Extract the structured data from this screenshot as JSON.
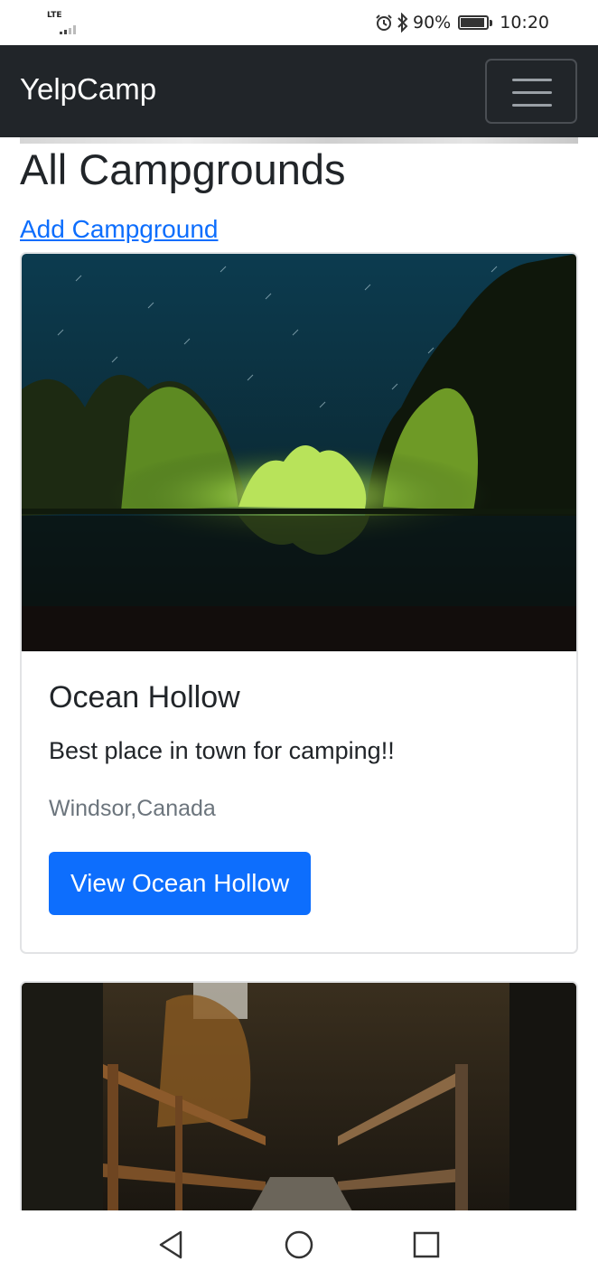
{
  "status_bar": {
    "network": "LTE",
    "battery": "90%",
    "time": "10:20"
  },
  "navbar": {
    "brand": "YelpCamp",
    "toggler_icon": "hamburger-icon"
  },
  "main": {
    "title": "All Campgrounds",
    "add_link": "Add Campground"
  },
  "campgrounds": [
    {
      "title": "Ocean Hollow",
      "description": "Best place in town for camping!!",
      "location": "Windsor,Canada",
      "button": "View Ocean Hollow",
      "image": "night-lake-forest"
    },
    {
      "image": "forest-bridge"
    }
  ],
  "colors": {
    "navbar_bg": "#212529",
    "primary": "#0d6efd",
    "muted": "#6c757d"
  },
  "system_nav": {
    "back_icon": "back-triangle-icon",
    "home_icon": "home-circle-icon",
    "recents_icon": "recents-square-icon"
  }
}
